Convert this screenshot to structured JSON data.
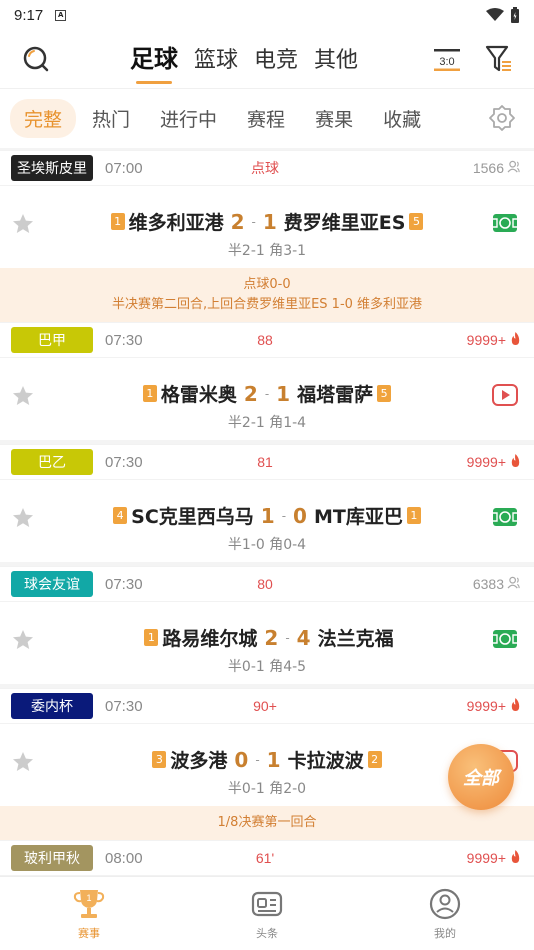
{
  "status_bar": {
    "time": "9:17",
    "sim_label": "A"
  },
  "sport_tabs": [
    {
      "label": "足球",
      "active": true
    },
    {
      "label": "篮球",
      "active": false
    },
    {
      "label": "电竞",
      "active": false
    },
    {
      "label": "其他",
      "active": false
    }
  ],
  "sub_tabs": [
    {
      "label": "完整",
      "active": true
    },
    {
      "label": "热门",
      "active": false
    },
    {
      "label": "进行中",
      "active": false
    },
    {
      "label": "赛程",
      "active": false
    },
    {
      "label": "赛果",
      "active": false
    },
    {
      "label": "收藏",
      "active": false
    }
  ],
  "icons": {
    "score_toggle": "3:0"
  },
  "colors": {
    "accent": "#f0a040",
    "hot": "#e05050",
    "score": "#c8802f",
    "note_bg": "#fdf0e3"
  },
  "matches": [
    {
      "league": "圣埃斯皮里",
      "league_color": "#222222",
      "time": "07:00",
      "status": "点球",
      "heat": "1566",
      "heat_type": "cold",
      "home_rank": "1",
      "home": "维多利亚港",
      "home_score": "2",
      "away_score": "1",
      "away": "费罗维里亚ES",
      "away_rank": "5",
      "sub": "半2-1 角3-1",
      "icon": "green",
      "note": [
        "点球0-0",
        "半决赛第二回合,上回合费罗维里亚ES 1-0 维多利亚港"
      ]
    },
    {
      "league": "巴甲",
      "league_color": "#c8c806",
      "time": "07:30",
      "status": "88",
      "heat": "9999+",
      "heat_type": "hot",
      "home_rank": "1",
      "home": "格雷米奥",
      "home_score": "2",
      "away_score": "1",
      "away": "福塔雷萨",
      "away_rank": "5",
      "sub": "半2-1 角1-4",
      "icon": "red",
      "note": []
    },
    {
      "league": "巴乙",
      "league_color": "#c8c806",
      "time": "07:30",
      "status": "81",
      "heat": "9999+",
      "heat_type": "hot",
      "home_rank": "4",
      "home": "SC克里西乌马",
      "home_score": "1",
      "away_score": "0",
      "away": "MT库亚巴",
      "away_rank": "1",
      "sub": "半1-0 角0-4",
      "icon": "green",
      "note": []
    },
    {
      "league": "球会友谊",
      "league_color": "#12a8a6",
      "time": "07:30",
      "status": "80",
      "heat": "6383",
      "heat_type": "cold",
      "home_rank": "1",
      "home": "路易维尔城",
      "home_score": "2",
      "away_score": "4",
      "away": "法兰克福",
      "away_rank": "",
      "sub": "半0-1 角4-5",
      "icon": "green",
      "note": []
    },
    {
      "league": "委内杯",
      "league_color": "#0a1a7a",
      "time": "07:30",
      "status": "90+",
      "heat": "9999+",
      "heat_type": "hot",
      "home_rank": "3",
      "home": "波多港",
      "home_score": "0",
      "away_score": "1",
      "away": "卡拉波波",
      "away_rank": "2",
      "sub": "半0-1 角2-0",
      "icon": "red",
      "note": [
        "1/8决赛第一回合"
      ]
    },
    {
      "league": "玻利甲秋",
      "league_color": "#a39560",
      "time": "08:00",
      "status": "61'",
      "heat": "9999+",
      "heat_type": "hot",
      "home_rank": "",
      "home": "",
      "home_score": "",
      "away_score": "",
      "away": "",
      "away_rank": "",
      "sub": "",
      "icon": "",
      "note": []
    }
  ],
  "float_button": "全部",
  "bottom_nav": [
    {
      "label": "赛事",
      "active": true
    },
    {
      "label": "头条",
      "active": false
    },
    {
      "label": "我的",
      "active": false
    }
  ]
}
